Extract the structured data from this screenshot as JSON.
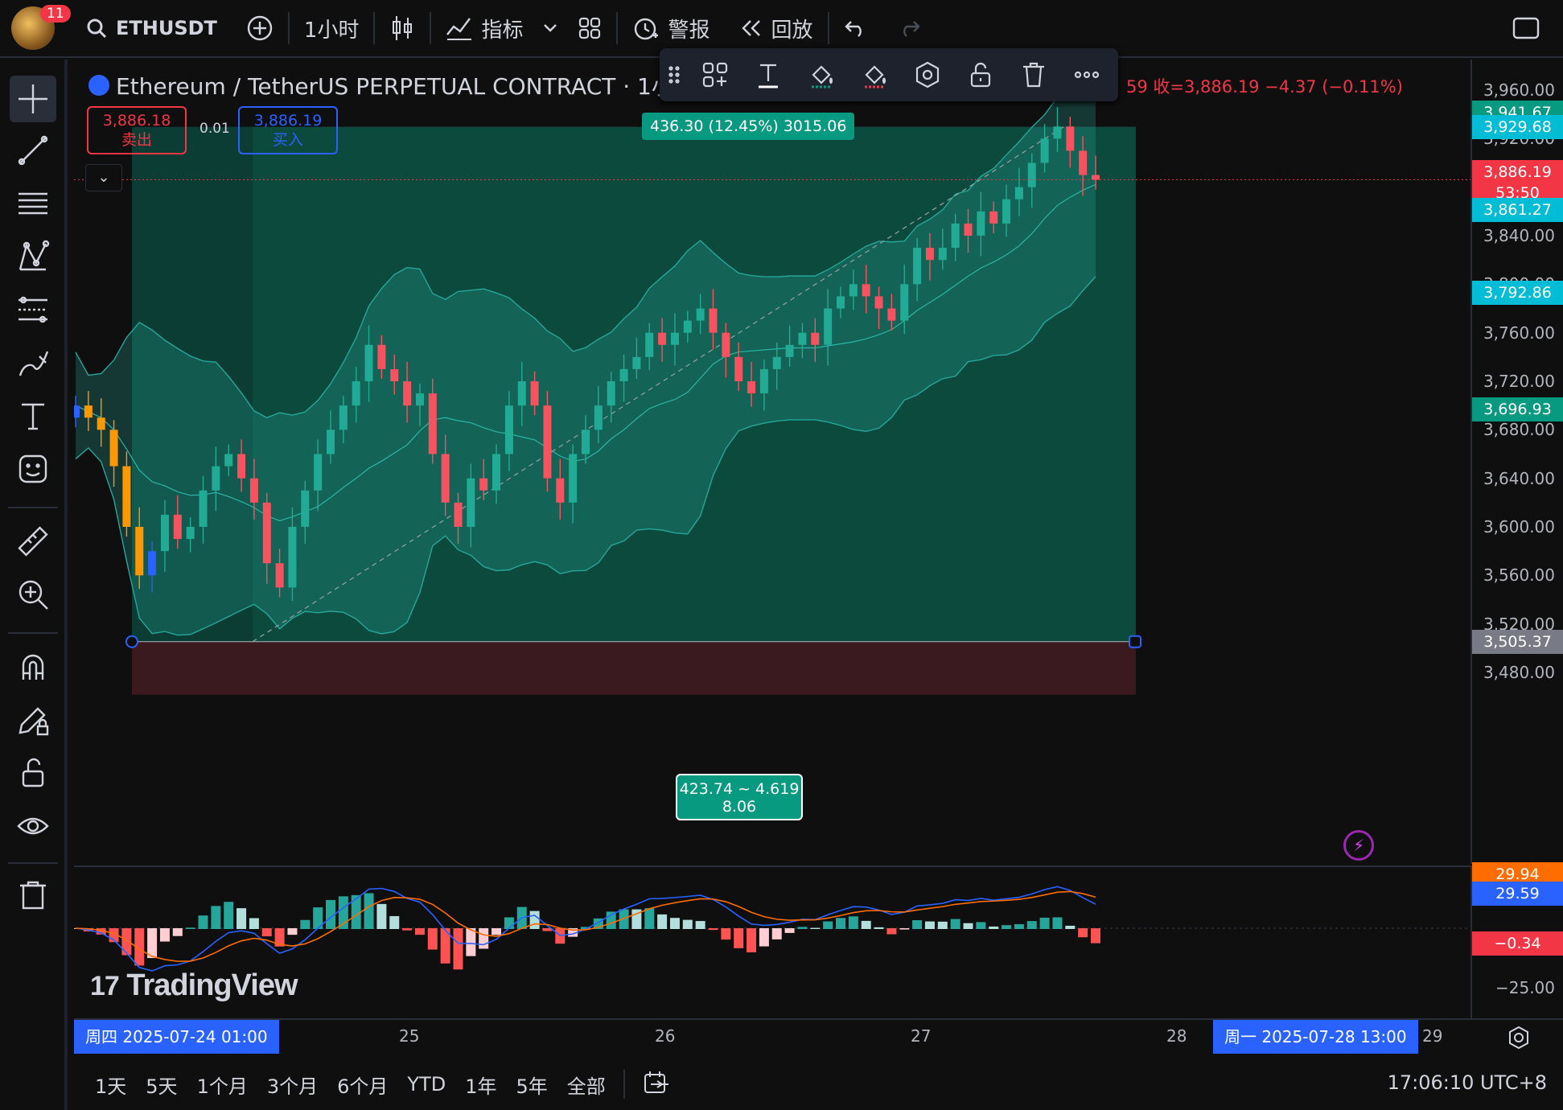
{
  "topbar": {
    "notification_count": "11",
    "symbol": "ETHUSDT",
    "interval": "1小时",
    "indicators_label": "指标",
    "alert_label": "警报",
    "replay_label": "回放"
  },
  "legend": {
    "title": "Ethereum / TetherUS PERPETUAL CONTRACT · 1小时 ·",
    "ohlc_partial": "59 收=3,886.19 −4.37 (−0.11%)",
    "sell_price": "3,886.18",
    "sell_label": "卖出",
    "spread": "0.01",
    "buy_price": "3,886.19",
    "buy_label": "买入"
  },
  "measure": {
    "top_label": "436.30 (12.45%) 3015.06",
    "bottom_line1": "423.74 ~ 4.619",
    "bottom_line2": "8.06"
  },
  "price_scale": {
    "ticks": [
      "3,960.00",
      "3,920.00",
      "3,840.00",
      "3,800.00",
      "3,760.00",
      "3,720.00",
      "3,680.00",
      "3,640.00",
      "3,600.00",
      "3,560.00",
      "3,520.00",
      "3,480.00"
    ],
    "labels": [
      {
        "text": "3,941.67",
        "color": "#089981"
      },
      {
        "text": "3,929.68",
        "color": "#00bcd4"
      },
      {
        "text": "3,886.19",
        "color": "#f23645"
      },
      {
        "text": "53:50",
        "color": "#f23645"
      },
      {
        "text": "3,861.27",
        "color": "#00bcd4"
      },
      {
        "text": "3,792.86",
        "color": "#00bcd4"
      },
      {
        "text": "3,696.93",
        "color": "#089981"
      },
      {
        "text": "3,505.37",
        "color": "#787b86"
      }
    ]
  },
  "macd_scale": {
    "labels": [
      {
        "text": "29.94",
        "color": "#ff6d00"
      },
      {
        "text": "29.59",
        "color": "#2962ff"
      },
      {
        "text": "−0.34",
        "color": "#f23645"
      }
    ],
    "tick": "−25.00"
  },
  "time_axis": {
    "start_highlight": "周四  2025-07-24   01:00",
    "labels": [
      "25",
      "26",
      "27",
      "28",
      "29"
    ],
    "end_highlight": "周一  2025-07-28   13:00"
  },
  "bottom": {
    "ranges": [
      "1天",
      "5天",
      "1个月",
      "3个月",
      "6个月",
      "YTD",
      "1年",
      "5年",
      "全部"
    ],
    "clock": "17:06:10 UTC+8"
  },
  "brand": "TradingView",
  "chart_data": {
    "type": "candlestick",
    "title": "",
    "ylim": [
      3460,
      3980
    ],
    "bollinger": true,
    "closes": [
      3700,
      3690,
      3680,
      3650,
      3600,
      3560,
      3580,
      3610,
      3590,
      3600,
      3630,
      3650,
      3660,
      3640,
      3620,
      3570,
      3550,
      3600,
      3630,
      3660,
      3680,
      3700,
      3720,
      3750,
      3730,
      3720,
      3700,
      3710,
      3660,
      3620,
      3600,
      3640,
      3630,
      3660,
      3700,
      3720,
      3700,
      3640,
      3620,
      3660,
      3680,
      3700,
      3720,
      3730,
      3740,
      3760,
      3750,
      3760,
      3770,
      3780,
      3760,
      3740,
      3720,
      3710,
      3730,
      3740,
      3750,
      3760,
      3750,
      3780,
      3790,
      3800,
      3790,
      3780,
      3770,
      3800,
      3830,
      3820,
      3830,
      3850,
      3840,
      3860,
      3850,
      3870,
      3880,
      3900,
      3920,
      3930,
      3910,
      3890,
      3886
    ]
  }
}
